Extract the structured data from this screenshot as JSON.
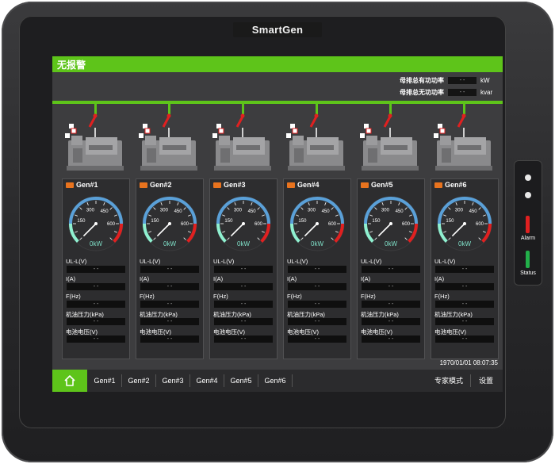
{
  "device": {
    "brand": "SmartGen"
  },
  "alarm_bar": {
    "text": "无报警",
    "color": "#5ec41a"
  },
  "bus": {
    "active_power": {
      "label": "母排总有功功率",
      "value": "- -",
      "unit": "kW"
    },
    "reactive_power": {
      "label": "母排总无功功率",
      "value": "- -",
      "unit": "kvar"
    }
  },
  "gauge_scale": {
    "t150": "150",
    "t300": "300",
    "t450": "450",
    "t600": "600"
  },
  "field_labels": {
    "ull": "UL-L(V)",
    "i": "I(A)",
    "f": "F(Hz)",
    "oil": "机油压力(kPa)",
    "bat": "电池电压(V)"
  },
  "gens": [
    {
      "title": "Gen#1",
      "kw": "0kW",
      "ull": "- -",
      "i": "- -",
      "f": "- -",
      "oil": "- -",
      "bat": "- -"
    },
    {
      "title": "Gen#2",
      "kw": "0kW",
      "ull": "- -",
      "i": "- -",
      "f": "- -",
      "oil": "- -",
      "bat": "- -"
    },
    {
      "title": "Gen#3",
      "kw": "0kW",
      "ull": "- -",
      "i": "- -",
      "f": "- -",
      "oil": "- -",
      "bat": "- -"
    },
    {
      "title": "Gen#4",
      "kw": "0kW",
      "ull": "- -",
      "i": "- -",
      "f": "- -",
      "oil": "- -",
      "bat": "- -"
    },
    {
      "title": "Gen#5",
      "kw": "0kW",
      "ull": "- -",
      "i": "- -",
      "f": "- -",
      "oil": "- -",
      "bat": "- -"
    },
    {
      "title": "Gen#6",
      "kw": "0kW",
      "ull": "- -",
      "i": "- -",
      "f": "- -",
      "oil": "- -",
      "bat": "- -"
    }
  ],
  "datetime": "1970/01/01 08:07:35",
  "nav": {
    "home_icon": "home-icon",
    "tabs": [
      "Gen#1",
      "Gen#2",
      "Gen#3",
      "Gen#4",
      "Gen#5",
      "Gen#6"
    ],
    "expert": "专家模式",
    "settings": "设置"
  },
  "side": {
    "alarm": "Alarm",
    "status": "Status",
    "alarm_color": "#e02020",
    "status_color": "#22b04a"
  }
}
